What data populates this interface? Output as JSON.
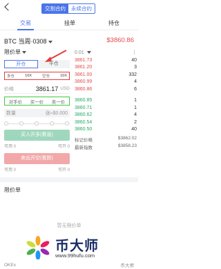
{
  "top": {
    "segments": [
      "交割合约",
      "永续合约"
    ],
    "active_segment": 0
  },
  "tabs": [
    "交易",
    "挂单",
    "持仓"
  ],
  "pair": {
    "name": "BTC 当周·0308",
    "last_price": "$3860.86"
  },
  "order_type": "限价单",
  "mode": [
    "开仓",
    "平仓"
  ],
  "leverage_row": {
    "long_label": "多仓",
    "long_value": "10X",
    "short_label": "空仓",
    "short_value": "10X"
  },
  "price_field": {
    "label": "价格",
    "value": "3861.17",
    "unit": "USD"
  },
  "quick_prices": [
    "对手价",
    "买一价",
    "卖一价"
  ],
  "qty_field": {
    "label": "数量",
    "unit": "张≈$0.000"
  },
  "buttons": {
    "long": "买入开多(看涨)",
    "short": "卖出开空(看跌)"
  },
  "avail_long": {
    "label": "可用 0",
    "right": "可开 0"
  },
  "avail_short": {
    "label": "可用 0",
    "right": "可开 0"
  },
  "orderbook": {
    "header": {
      "depth": "0.01",
      "label": ""
    },
    "asks": [
      {
        "price": "3861.73",
        "qty": "40"
      },
      {
        "price": "3861.20",
        "qty": "3"
      },
      {
        "price": "3861.00",
        "qty": "332"
      },
      {
        "price": "3860.99",
        "qty": "4"
      },
      {
        "price": "3860.86",
        "qty": "6"
      }
    ],
    "bids": [
      {
        "price": "3860.85",
        "qty": "1"
      },
      {
        "price": "3860.71",
        "qty": "1"
      },
      {
        "price": "3860.62",
        "qty": "4"
      },
      {
        "price": "3860.54",
        "qty": "2"
      },
      {
        "price": "3860.50",
        "qty": "40"
      }
    ],
    "mark_price": {
      "label": "标记价格",
      "value": "$3862.02"
    },
    "index_price": {
      "label": "最新指数",
      "value": "$3858.23"
    }
  },
  "limit_section": {
    "title": "限价单",
    "empty": "暂无限价单"
  },
  "watermark": {
    "title": "币大师",
    "url": "www.99hufu.com"
  },
  "bottom": {
    "left": "OKEx",
    "right": "币大师"
  }
}
